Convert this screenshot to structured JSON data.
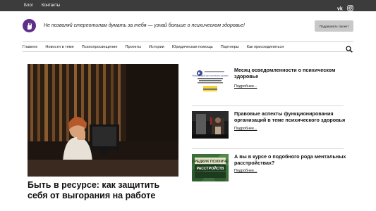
{
  "topbar": {
    "links": [
      "Блог",
      "Контакты"
    ],
    "social_icons": [
      "vk-icon",
      "instagram-icon"
    ],
    "background": "#3c3c3c"
  },
  "header": {
    "logo_icon": "hand-logo-icon",
    "tagline": "Не позволяй стереотипам думать за тебя — узнай больше о психическом здоровье!",
    "support_button": "Поддержать проект",
    "brand_color": "#5e2f8a"
  },
  "nav": {
    "items": [
      "Главное",
      "Новости в теме",
      "Психопросвещение",
      "Проекты",
      "Истории",
      "Юридическая помощь",
      "Партнеры",
      "Как присоединиться"
    ],
    "search_icon": "search-icon"
  },
  "featured": {
    "title": "Быть в ресурсе: как защитить себя от выгорания на работе"
  },
  "articles": [
    {
      "title": "Месяц осведомленности о психическом здоровье",
      "more": "Подробнее...",
      "thumb_caption": "Международный день психического здоровья"
    },
    {
      "title": "Правовые аспекты функционирования организаций в теме психического здоровья",
      "more": "Подробнее..."
    },
    {
      "title": "А вы в курсе о подобного рода ментальных расстройствах?",
      "more": "Подробнее...",
      "thumb_caption": "ТОП-5 РЕДКИХ ПСИХИЧЕСКИХ РАССТРОЙСТВ"
    }
  ]
}
